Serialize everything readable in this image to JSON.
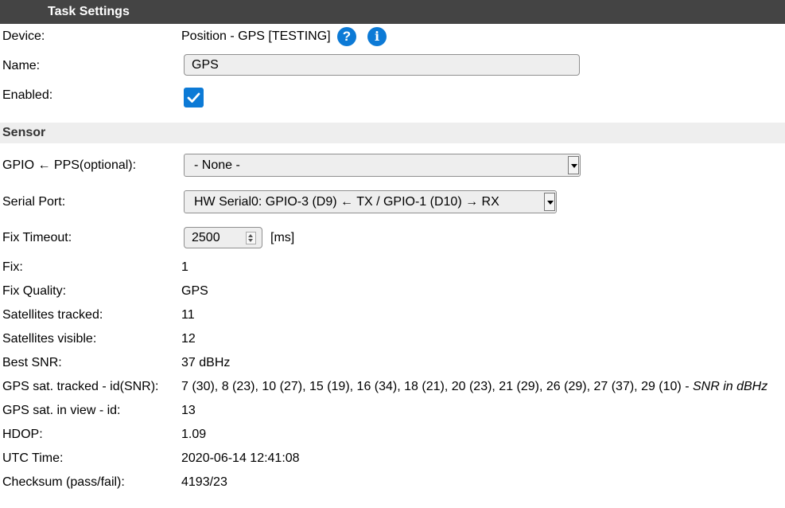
{
  "header": {
    "title": "Task Settings"
  },
  "device": {
    "label": "Device:",
    "value": "Position - GPS [TESTING]",
    "help_icon": "question-circle-icon",
    "info_icon": "info-circle-icon"
  },
  "name": {
    "label": "Name:",
    "value": "GPS"
  },
  "enabled": {
    "label": "Enabled:",
    "checked": true
  },
  "sensor_section": {
    "title": "Sensor"
  },
  "gpio_pps": {
    "label": "GPIO ← PPS(optional):",
    "selected": "- None -"
  },
  "serial_port": {
    "label": "Serial Port:",
    "selected": "HW Serial0: GPIO-3 (D9) ← TX / GPIO-1 (D10) → RX"
  },
  "fix_timeout": {
    "label": "Fix Timeout:",
    "value": "2500",
    "unit": "[ms]"
  },
  "readouts": [
    {
      "label": "Fix:",
      "value": "1"
    },
    {
      "label": "Fix Quality:",
      "value": "GPS"
    },
    {
      "label": "Satellites tracked:",
      "value": "11"
    },
    {
      "label": "Satellites visible:",
      "value": "12"
    },
    {
      "label": "Best SNR:",
      "value": "37 dBHz"
    },
    {
      "label": "GPS sat. tracked - id(SNR):",
      "value": "7 (30), 8 (23), 10 (27), 15 (19), 16 (34), 18 (21), 20 (23), 21 (29), 26 (29), 27 (37), 29 (10) - ",
      "note": "SNR in dBHz"
    },
    {
      "label": "GPS sat. in view - id:",
      "value": "13"
    },
    {
      "label": "HDOP:",
      "value": "1.09"
    },
    {
      "label": "UTC Time:",
      "value": "2020-06-14 12:41:08"
    },
    {
      "label": "Checksum (pass/fail):",
      "value": "4193/23"
    }
  ],
  "colors": {
    "header_bg": "#444444",
    "accent": "#0c7ad6",
    "section_bg": "#eeeeee"
  }
}
